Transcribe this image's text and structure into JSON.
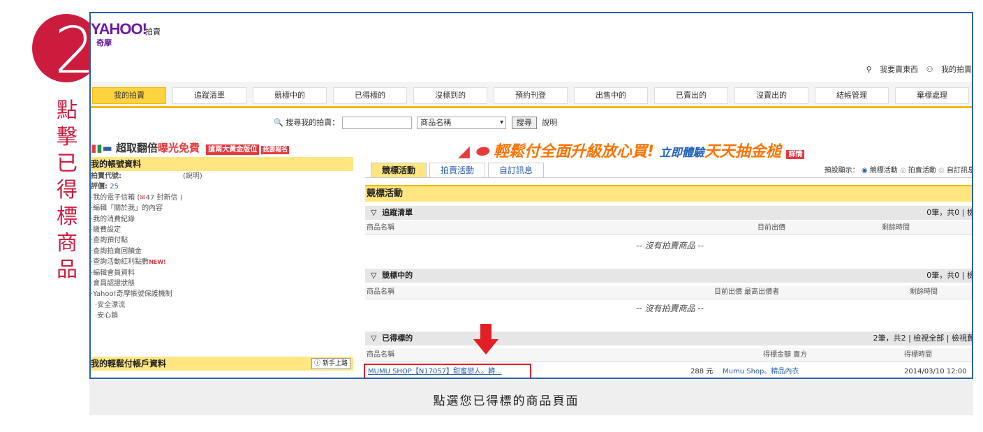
{
  "annotation": {
    "step_number": "2",
    "step_text": [
      "點",
      "擊",
      "已",
      "得",
      "標",
      "商",
      "品"
    ],
    "caption": "點選您已得標的商品頁面"
  },
  "header": {
    "logo": "YAHOO!",
    "logo_sub": "奇摩",
    "section": "拍賣",
    "links": [
      "我要賣東西",
      "我的拍賣"
    ]
  },
  "tabs": [
    "我的拍賣",
    "追蹤清單",
    "競標中的",
    "已得標的",
    "沒標到的",
    "預約刊登",
    "出售中的",
    "已賣出的",
    "沒賣出的",
    "結帳管理",
    "棄標處理"
  ],
  "search": {
    "label": "搜尋我的拍賣：",
    "select_value": "商品名稱",
    "button": "搜尋",
    "help": "說明"
  },
  "left": {
    "banner": {
      "a": "超取翻倍",
      "b": "曝光免費",
      "tag": "搶兩大黃金版位",
      "tag2": "我要報名"
    },
    "account_title": "我的帳號資料",
    "seller_id_label": "拍賣代號:",
    "seller_id_help": "(說明)",
    "rating_label": "評價:",
    "rating_value": "25",
    "items": [
      "‧我的電子信箱 (",
      "‧編輯「關於我」的內容",
      "‧我的消費紀錄",
      "‧繳費設定",
      "‧查詢預付點",
      "‧查詢拍賣回饋金",
      "‧查詢活動紅利點數",
      "‧編輯會員資料",
      "‧會員認證狀態",
      "‧Yahoo!奇摩帳號保護機制",
      "  ‧安全漂流",
      "  ‧安心鎖"
    ],
    "mail_count": "47 封新信 )",
    "new_badge": "NEW!",
    "payment_title": "我的輕鬆付帳戶資料",
    "newbie_button": "新手上路"
  },
  "right": {
    "banner": {
      "a": "輕鬆付",
      "b": "全面升級放心買!",
      "c": "立即體驗",
      "d": "天天抽金槌",
      "e": "詳情"
    },
    "subtabs": [
      "競標活動",
      "拍賣活動",
      "自訂訊息"
    ],
    "display_label": "預設顯示：",
    "display_options": [
      "競標活動",
      "拍賣活動",
      "自訂訊息"
    ],
    "section_title": "競標活動",
    "sections": [
      {
        "title": "追蹤清單",
        "count": "0筆，共0 | 檢",
        "cols": [
          "商品名稱",
          "目前出價",
          "剩餘時間"
        ],
        "empty": "-- 沒有拍賣商品 --"
      },
      {
        "title": "競標中的",
        "count": "0筆，共0 | 檢",
        "cols": [
          "商品名稱",
          "目前出價  最高出價者",
          "剩餘時間"
        ],
        "empty": "-- 沒有拍賣商品 --"
      },
      {
        "title": "已得標的",
        "count": "2筆，共2 | 檢視全部 | 檢視舊",
        "cols": [
          "商品名稱",
          "得標金額  賣方",
          "得標時間"
        ]
      }
    ],
    "won_row": {
      "item": "MUMU SHOP【N17057】甜蜜戀人。韓...",
      "price": "288 元",
      "seller": "Mumu Shop。精品內衣",
      "time": "2014/03/10 12:00"
    }
  }
}
